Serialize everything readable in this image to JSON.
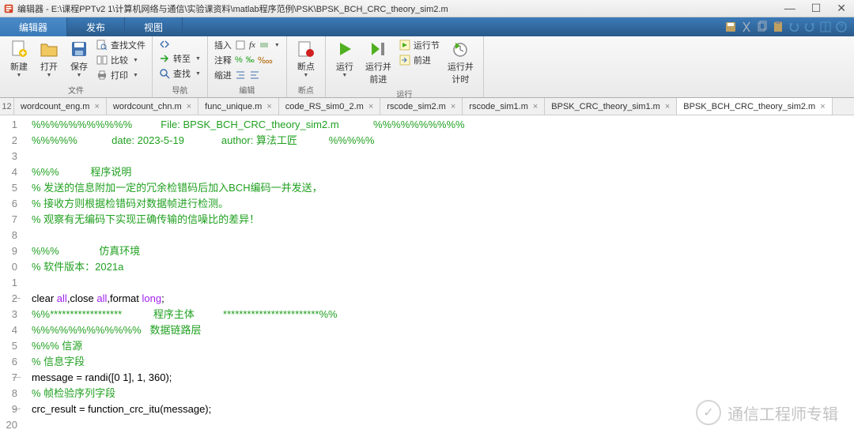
{
  "titlebar": {
    "title": "编辑器 - E:\\课程PPTv2 1\\计算机网络与通信\\实验课资料\\matlab程序范例\\PSK\\BPSK_BCH_CRC_theory_sim2.m"
  },
  "ribbon": {
    "tabs": [
      "编辑器",
      "发布",
      "视图"
    ],
    "active_tab": 0,
    "groups": {
      "file": {
        "label": "文件",
        "new": "新建",
        "open": "打开",
        "save": "保存",
        "findfiles": "查找文件",
        "compare": "比较",
        "print": "打印"
      },
      "nav": {
        "label": "导航",
        "goto": "转至",
        "find": "查找"
      },
      "edit": {
        "label": "编辑",
        "insert": "插入",
        "comment": "注释",
        "indent": "缩进"
      },
      "bp": {
        "label": "断点",
        "breakpoints": "断点"
      },
      "run": {
        "label": "运行",
        "run": "运行",
        "run_advance": "运行并\n前进",
        "run_section": "运行节",
        "advance": "前进",
        "run_time": "运行并\n计时"
      }
    }
  },
  "file_tabs": {
    "line_toggle": "12",
    "tabs": [
      {
        "name": "wordcount_eng.m",
        "active": false
      },
      {
        "name": "wordcount_chn.m",
        "active": false
      },
      {
        "name": "func_unique.m",
        "active": false
      },
      {
        "name": "code_RS_sim0_2.m",
        "active": false
      },
      {
        "name": "rscode_sim2.m",
        "active": false
      },
      {
        "name": "rscode_sim1.m",
        "active": false
      },
      {
        "name": "BPSK_CRC_theory_sim1.m",
        "active": false
      },
      {
        "name": "BPSK_BCH_CRC_theory_sim2.m",
        "active": true
      }
    ]
  },
  "editor": {
    "first_line_no": 1,
    "lines": [
      {
        "n": "1",
        "t": "comment",
        "text": "%%%%%%%%%%%          File: BPSK_BCH_CRC_theory_sim2.m            %%%%%%%%%%"
      },
      {
        "n": "2",
        "t": "comment",
        "text": "%%%%%            date: 2023-5-19             author: 算法工匠           %%%%%"
      },
      {
        "n": "3",
        "t": "blank",
        "text": ""
      },
      {
        "n": "4",
        "t": "comment",
        "text": "%%%           程序说明"
      },
      {
        "n": "5",
        "t": "comment",
        "text": "% 发送的信息附加一定的冗余检错码后加入BCH编码一并发送，"
      },
      {
        "n": "6",
        "t": "comment",
        "text": "% 接收方则根据检错码对数据帧进行检测。"
      },
      {
        "n": "7",
        "t": "comment",
        "text": "% 观察有无编码下实现正确传输的信噪比的差异！"
      },
      {
        "n": "8",
        "t": "blank",
        "text": ""
      },
      {
        "n": "9",
        "t": "comment",
        "text": "%%%              仿真环境"
      },
      {
        "n": "0",
        "t": "comment",
        "text": "% 软件版本：2021a"
      },
      {
        "n": "1",
        "t": "blank",
        "text": ""
      },
      {
        "n": "2",
        "t": "code",
        "dash": true,
        "html": "clear <span class='string'>all</span>,close <span class='string'>all</span>,format <span class='string'>long</span>;"
      },
      {
        "n": "3",
        "t": "comment",
        "text": "%%******************           程序主体          ************************%%"
      },
      {
        "n": "4",
        "t": "comment",
        "text": "%%%%%%%%%%%%   数据链路层"
      },
      {
        "n": "5",
        "t": "comment",
        "text": "%%% 信源"
      },
      {
        "n": "6",
        "t": "comment",
        "text": "% 信息字段"
      },
      {
        "n": "7",
        "t": "code",
        "dash": true,
        "html": "message = randi([0 1], 1, 360);"
      },
      {
        "n": "8",
        "t": "comment",
        "text": "% 帧检验序列字段"
      },
      {
        "n": "9",
        "t": "code",
        "dash": true,
        "html": "crc_result = function_crc_itu(message);"
      },
      {
        "n": "20",
        "t": "blank",
        "text": ""
      }
    ]
  },
  "watermark": {
    "text": "通信工程师专辑",
    "icon": "✓"
  }
}
